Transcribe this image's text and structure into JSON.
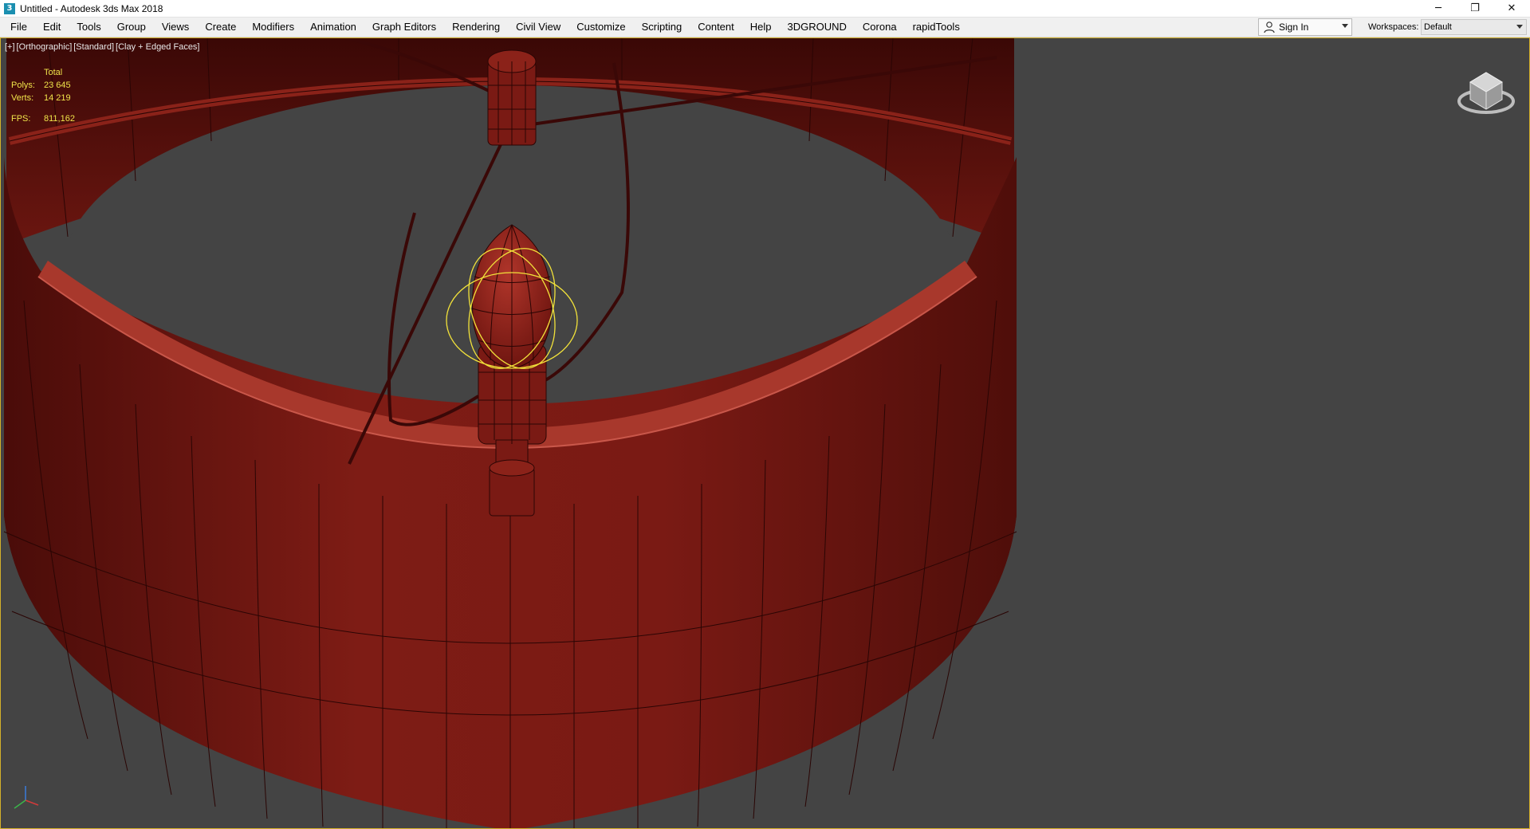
{
  "window": {
    "title": "Untitled - Autodesk 3ds Max 2018",
    "app_icon_glyph": "3",
    "controls": {
      "minimize": "─",
      "restore": "❐",
      "close": "✕"
    }
  },
  "menu": {
    "items": [
      "File",
      "Edit",
      "Tools",
      "Group",
      "Views",
      "Create",
      "Modifiers",
      "Animation",
      "Graph Editors",
      "Rendering",
      "Civil View",
      "Customize",
      "Scripting",
      "Content",
      "Help",
      "3DGROUND",
      "Corona",
      "rapidTools"
    ],
    "sign_in": "Sign In",
    "workspaces_label": "Workspaces:",
    "workspace_value": "Default"
  },
  "viewport": {
    "labels": [
      "[+]",
      "[Orthographic]",
      "[Standard]",
      "[Clay + Edged Faces]"
    ],
    "stats": {
      "header": "Total",
      "polys_label": "Polys:",
      "polys_value": "23 645",
      "verts_label": "Verts:",
      "verts_value": "14 219",
      "fps_label": "FPS:",
      "fps_value": "811,162"
    }
  },
  "colors": {
    "viewport_bg": "#444444",
    "clay_red": "#7a1a14",
    "selection_yellow": "#f2e23a",
    "frame_border": "#d3b12a"
  },
  "icons": [
    "app-icon",
    "user-icon",
    "viewcube-icon",
    "axis-tripod-icon"
  ]
}
